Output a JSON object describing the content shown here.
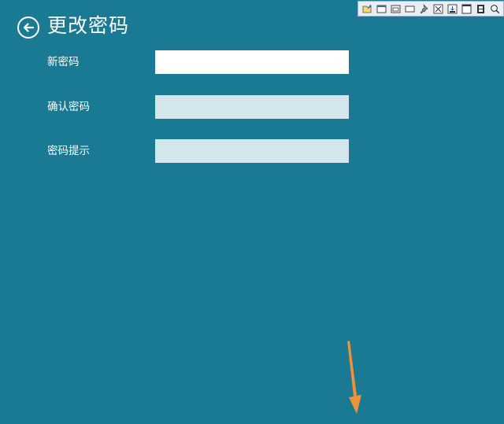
{
  "header": {
    "title": "更改密码",
    "back_icon": "arrow-left-circle-icon"
  },
  "form": {
    "fields": [
      {
        "label": "新密码",
        "value": "",
        "state": "active"
      },
      {
        "label": "确认密码",
        "value": "",
        "state": "inactive"
      },
      {
        "label": "密码提示",
        "value": "",
        "state": "inactive"
      }
    ]
  },
  "toolbar": {
    "icons": [
      "open-icon",
      "window-icon",
      "window-frame-icon",
      "rectangle-icon",
      "pin-icon",
      "close-box-icon",
      "save-icon",
      "fullscreen-icon",
      "film-icon",
      "search-icon"
    ]
  },
  "annotation": {
    "arrow_icon": "arrow-down-icon",
    "arrow_color": "#f0913a"
  },
  "colors": {
    "background": "#1a7a93",
    "active_input": "#ffffff",
    "inactive_input": "#d3e6ec",
    "text": "#ffffff"
  }
}
